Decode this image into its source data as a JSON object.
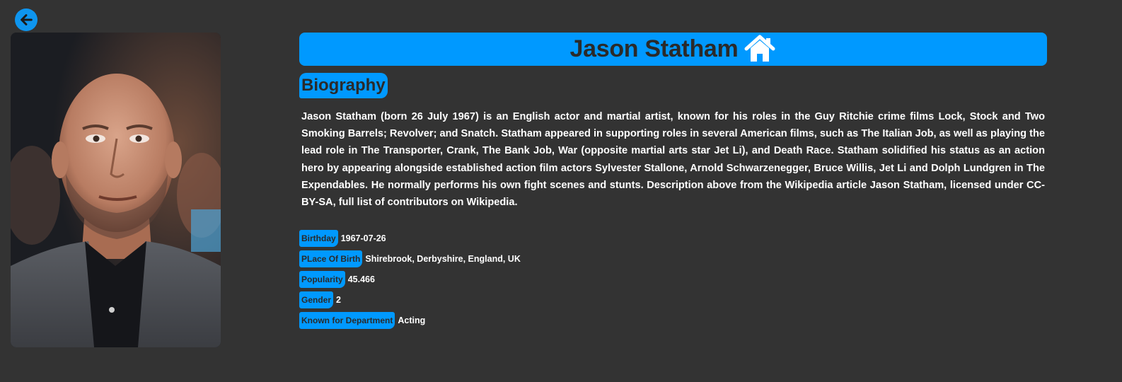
{
  "nav": {
    "back_icon": "arrow-left-circle-icon",
    "home_icon": "home-icon",
    "accent_color": "#0099ff"
  },
  "person": {
    "name": "Jason Statham",
    "photo_alt": "Jason Statham"
  },
  "biography": {
    "heading": "Biography",
    "text": "Jason Statham (born 26 July 1967) is an English actor and martial artist, known for his roles in the Guy Ritchie crime films Lock, Stock and Two Smoking Barrels; Revolver; and Snatch. Statham appeared in supporting roles in several American films, such as The Italian Job, as well as playing the lead role in The Transporter, Crank, The Bank Job, War (opposite martial arts star Jet Li), and Death Race. Statham solidified his status as an action hero by appearing alongside established action film actors Sylvester Stallone, Arnold Schwarzenegger, Bruce Willis, Jet Li and Dolph Lundgren in The Expendables. He normally performs his own fight scenes and stunts. Description above from the Wikipedia article Jason Statham, licensed under CC-BY-SA, full list of contributors on Wikipedia."
  },
  "details": [
    {
      "label": "Birthday",
      "value": "1967-07-26"
    },
    {
      "label": "PLace Of Birth",
      "value": "Shirebrook, Derbyshire, England, UK"
    },
    {
      "label": "Popularity",
      "value": "45.466"
    },
    {
      "label": "Gender",
      "value": "2"
    },
    {
      "label": "Known for Department",
      "value": "Acting"
    }
  ]
}
